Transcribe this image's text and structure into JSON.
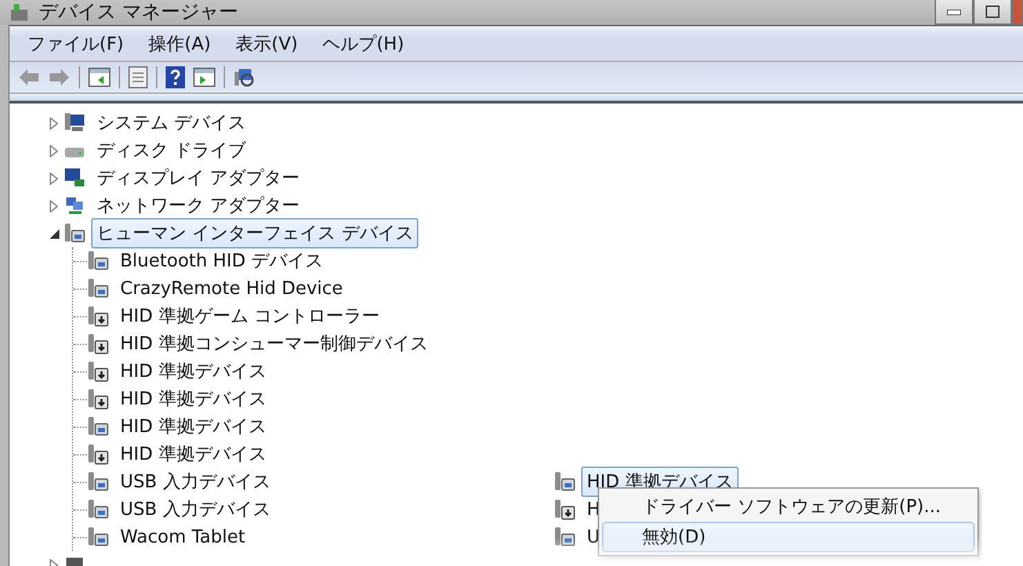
{
  "window": {
    "title": "デバイス マネージャー"
  },
  "menu": [
    {
      "label": "ファイル(F)"
    },
    {
      "label": "操作(A)"
    },
    {
      "label": "表示(V)"
    },
    {
      "label": "ヘルプ(H)"
    }
  ],
  "tree": [
    {
      "label": "システム デバイス",
      "kind": "system",
      "expanded": false,
      "selected": false
    },
    {
      "label": "ディスク ドライブ",
      "kind": "disk",
      "expanded": false,
      "selected": false
    },
    {
      "label": "ディスプレイ アダプター",
      "kind": "display",
      "expanded": false,
      "selected": false
    },
    {
      "label": "ネットワーク アダプター",
      "kind": "network",
      "expanded": false,
      "selected": false
    },
    {
      "label": "ヒューマン インターフェイス デバイス",
      "kind": "hid",
      "expanded": true,
      "selected": true,
      "children": [
        {
          "label": "Bluetooth HID デバイス",
          "kind": "hid"
        },
        {
          "label": "CrazyRemote Hid Device",
          "kind": "hid"
        },
        {
          "label": "HID 準拠ゲーム コントローラー",
          "kind": "hid-driver"
        },
        {
          "label": "HID 準拠コンシューマー制御デバイス",
          "kind": "hid-driver"
        },
        {
          "label": "HID 準拠デバイス",
          "kind": "hid-driver"
        },
        {
          "label": "HID 準拠デバイス",
          "kind": "hid-driver"
        },
        {
          "label": "HID 準拠デバイス",
          "kind": "hid"
        },
        {
          "label": "HID 準拠デバイス",
          "kind": "hid-driver"
        },
        {
          "label": "USB 入力デバイス",
          "kind": "hid"
        },
        {
          "label": "USB 入力デバイス",
          "kind": "hid"
        },
        {
          "label": "Wacom Tablet",
          "kind": "hid"
        }
      ]
    },
    {
      "kind": "processor",
      "expanded": false
    }
  ],
  "inset": {
    "rows": [
      {
        "label": "HID 準拠デバイス",
        "kind": "hid",
        "selected": true
      },
      {
        "label": "H",
        "kind": "hid-driver",
        "selected": false
      },
      {
        "label": "U",
        "kind": "hid",
        "selected": false
      }
    ],
    "context_menu": [
      {
        "label": "ドライバー ソフトウェアの更新(P)...",
        "selected": false
      },
      {
        "label": "無効(D)",
        "selected": true
      }
    ]
  }
}
